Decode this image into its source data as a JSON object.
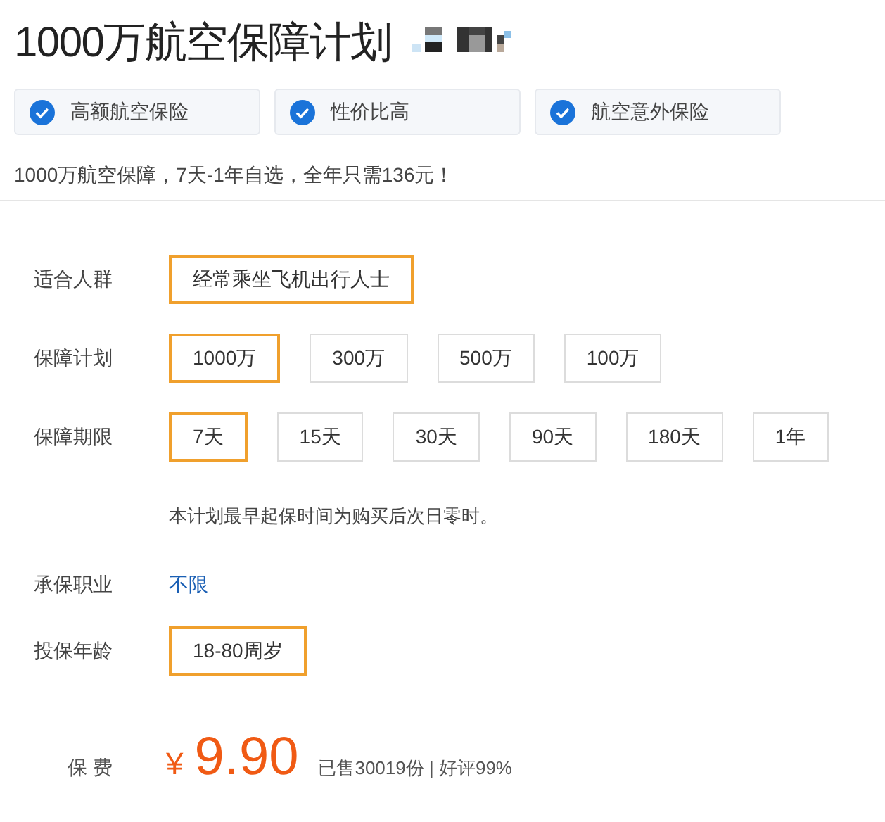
{
  "title": "1000万航空保障计划",
  "features": [
    {
      "label": "高额航空保险"
    },
    {
      "label": "性价比高"
    },
    {
      "label": "航空意外保险"
    }
  ],
  "tagline": "1000万航空保障，7天-1年自选，全年只需136元！",
  "rows": [
    {
      "kind": "options",
      "label": "适合人群",
      "options": [
        {
          "label": "经常乘坐飞机出行人士",
          "selected": true
        }
      ]
    },
    {
      "kind": "options",
      "label": "保障计划",
      "options": [
        {
          "label": "1000万",
          "selected": true
        },
        {
          "label": "300万",
          "selected": false
        },
        {
          "label": "500万",
          "selected": false
        },
        {
          "label": "100万",
          "selected": false
        }
      ]
    },
    {
      "kind": "options",
      "label": "保障期限",
      "options": [
        {
          "label": "7天",
          "selected": true
        },
        {
          "label": "15天",
          "selected": false
        },
        {
          "label": "30天",
          "selected": false
        },
        {
          "label": "90天",
          "selected": false
        },
        {
          "label": "180天",
          "selected": false
        },
        {
          "label": "1年",
          "selected": false
        }
      ]
    },
    {
      "kind": "note",
      "text": "本计划最早起保时间为购买后次日零时。"
    },
    {
      "kind": "value",
      "label": "承保职业",
      "value": "不限"
    },
    {
      "kind": "options",
      "label": "投保年龄",
      "options": [
        {
          "label": "18-80周岁",
          "selected": true
        }
      ]
    }
  ],
  "price": {
    "label": "保 费",
    "currency": "¥",
    "amount": "9.90",
    "stats": "已售30019份 | 好评99%"
  }
}
